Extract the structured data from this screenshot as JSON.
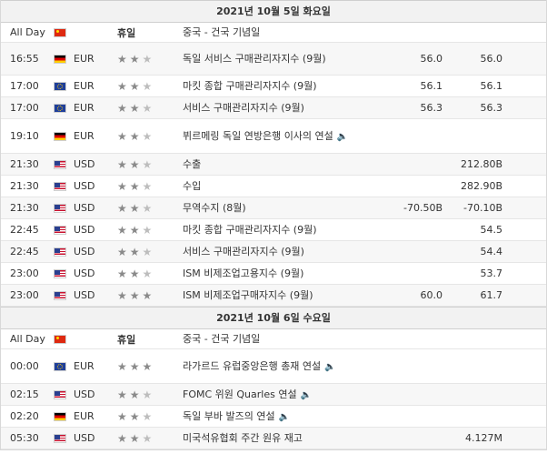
{
  "sections": [
    {
      "date": "2021년 10월 5일 화요일",
      "rows": [
        {
          "time": "All Day",
          "flag": "CN",
          "currency": "",
          "importance": "휴일",
          "event": "중국 - 건국 기념일",
          "actual": "",
          "forecast": "",
          "h": 22,
          "alt": false
        },
        {
          "time": "16:55",
          "flag": "DE",
          "currency": "EUR",
          "stars": 2,
          "event": "독일 서비스 구매관리자지수 (9월)",
          "actual": "56.0",
          "forecast": "56.0",
          "h": 36,
          "alt": true
        },
        {
          "time": "17:00",
          "flag": "EU",
          "currency": "EUR",
          "stars": 2,
          "event": "마킷 종합 구매관리자지수 (9월)",
          "actual": "56.1",
          "forecast": "56.1",
          "h": 24,
          "alt": false
        },
        {
          "time": "17:00",
          "flag": "EU",
          "currency": "EUR",
          "stars": 2,
          "event": "서비스 구매관리자지수 (9월)",
          "actual": "56.3",
          "forecast": "56.3",
          "h": 24,
          "alt": true
        },
        {
          "time": "19:10",
          "flag": "DE",
          "currency": "EUR",
          "stars": 2,
          "event": "뷔르메링 독일 연방은행 이사의 연설",
          "speaker": true,
          "actual": "",
          "forecast": "",
          "h": 38,
          "alt": false
        },
        {
          "time": "21:30",
          "flag": "US",
          "currency": "USD",
          "stars": 2,
          "event": "수출",
          "actual": "",
          "forecast": "212.80B",
          "h": 24,
          "alt": true
        },
        {
          "time": "21:30",
          "flag": "US",
          "currency": "USD",
          "stars": 2,
          "event": "수입",
          "actual": "",
          "forecast": "282.90B",
          "h": 24,
          "alt": false
        },
        {
          "time": "21:30",
          "flag": "US",
          "currency": "USD",
          "stars": 2,
          "event": "무역수지 (8월)",
          "actual": "-70.50B",
          "forecast": "-70.10B",
          "h": 24,
          "alt": true
        },
        {
          "time": "22:45",
          "flag": "US",
          "currency": "USD",
          "stars": 2,
          "event": "마킷 종합 구매관리자지수 (9월)",
          "actual": "",
          "forecast": "54.5",
          "h": 24,
          "alt": false
        },
        {
          "time": "22:45",
          "flag": "US",
          "currency": "USD",
          "stars": 2,
          "event": "서비스 구매관리자지수 (9월)",
          "actual": "",
          "forecast": "54.4",
          "h": 24,
          "alt": true
        },
        {
          "time": "23:00",
          "flag": "US",
          "currency": "USD",
          "stars": 2,
          "event": "ISM 비제조업고용지수 (9월)",
          "actual": "",
          "forecast": "53.7",
          "h": 24,
          "alt": false
        },
        {
          "time": "23:00",
          "flag": "US",
          "currency": "USD",
          "stars": 3,
          "event": "ISM 비제조업구매자지수 (9월)",
          "actual": "60.0",
          "forecast": "61.7",
          "h": 24,
          "alt": true
        }
      ]
    },
    {
      "date": "2021년 10월 6일 수요일",
      "rows": [
        {
          "time": "All Day",
          "flag": "CN",
          "currency": "",
          "importance": "휴일",
          "event": "중국 - 건국 기념일",
          "actual": "",
          "forecast": "",
          "h": 22,
          "alt": false
        },
        {
          "time": "00:00",
          "flag": "EU",
          "currency": "EUR",
          "stars": 3,
          "event": "라가르드 유럽중앙은행 총재 연설",
          "speaker": true,
          "actual": "",
          "forecast": "",
          "h": 38,
          "alt": false
        },
        {
          "time": "02:15",
          "flag": "US",
          "currency": "USD",
          "stars": 2,
          "event": "FOMC 위원 Quarles 연설",
          "speaker": true,
          "actual": "",
          "forecast": "",
          "h": 24,
          "alt": true
        },
        {
          "time": "02:20",
          "flag": "DE",
          "currency": "EUR",
          "stars": 2,
          "event": "독일 부바 발즈의 연설",
          "speaker": true,
          "actual": "",
          "forecast": "",
          "h": 24,
          "alt": false
        },
        {
          "time": "05:30",
          "flag": "US",
          "currency": "USD",
          "stars": 2,
          "event": "미국석유협회 주간 원유 재고",
          "actual": "",
          "forecast": "4.127M",
          "h": 24,
          "alt": true
        }
      ]
    }
  ]
}
